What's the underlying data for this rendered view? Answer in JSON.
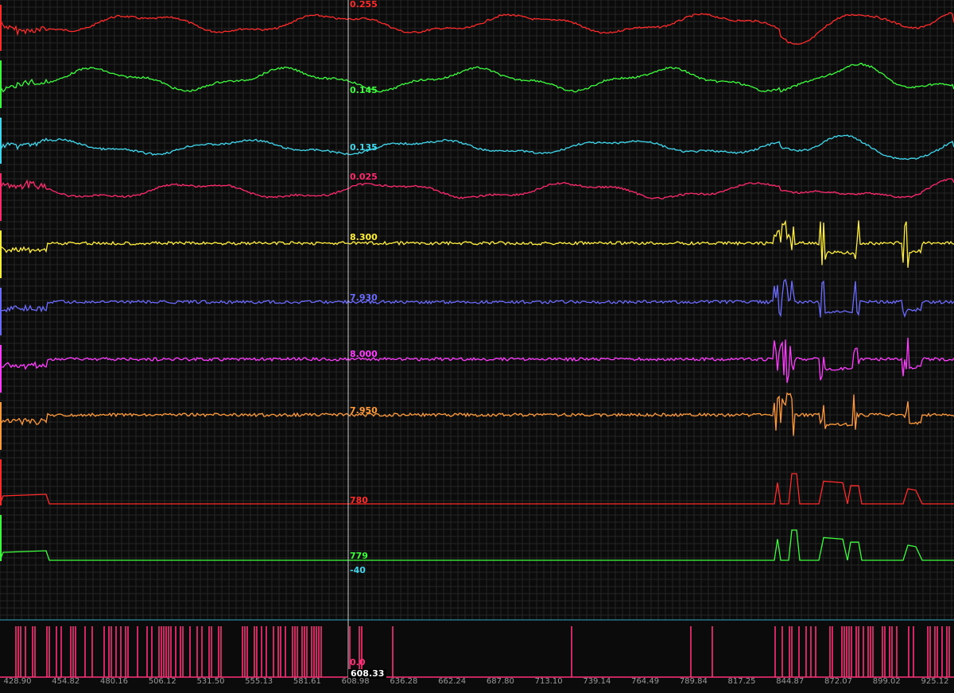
{
  "colors": {
    "background": "#0b0b0b",
    "grid": "#262626",
    "divider": "#2fa6c4",
    "cursor": "#cfcfcf",
    "event": "#ff2f7a"
  },
  "channels": [
    {
      "color": "#ff2a2a",
      "readout": "0.255",
      "kind": "wave"
    },
    {
      "color": "#3cff3c",
      "readout": "0.145",
      "kind": "wave"
    },
    {
      "color": "#3fd9ef",
      "readout": "0.135",
      "kind": "wave"
    },
    {
      "color": "#ff2a6e",
      "readout": "0.025",
      "kind": "wave"
    },
    {
      "color": "#ffee3a",
      "readout": "8.300",
      "kind": "noise"
    },
    {
      "color": "#6b6bff",
      "readout": "7.930",
      "kind": "noise"
    },
    {
      "color": "#ff3cff",
      "readout": "8.000",
      "kind": "noise"
    },
    {
      "color": "#ff9a3a",
      "readout": "7.950",
      "kind": "noise"
    },
    {
      "color": "#ff2a2a",
      "readout": "780",
      "kind": "step"
    },
    {
      "color": "#3cff3c",
      "readout": "779",
      "kind": "step"
    }
  ],
  "extra_readout": {
    "text": "-40",
    "color": "#3fd9ef"
  },
  "event_readout": {
    "text": "0.0",
    "color": "#ff2f7a"
  },
  "cursor_time": "608.33",
  "time_ticks": [
    "428.90",
    "454.82",
    "480.16",
    "506.12",
    "531.50",
    "555.13",
    "581.61",
    "608.98",
    "636.28",
    "662.24",
    "687.80",
    "713.10",
    "739.14",
    "764.49",
    "789.84",
    "817.25",
    "844.87",
    "872.07",
    "899.02",
    "925.12"
  ]
}
